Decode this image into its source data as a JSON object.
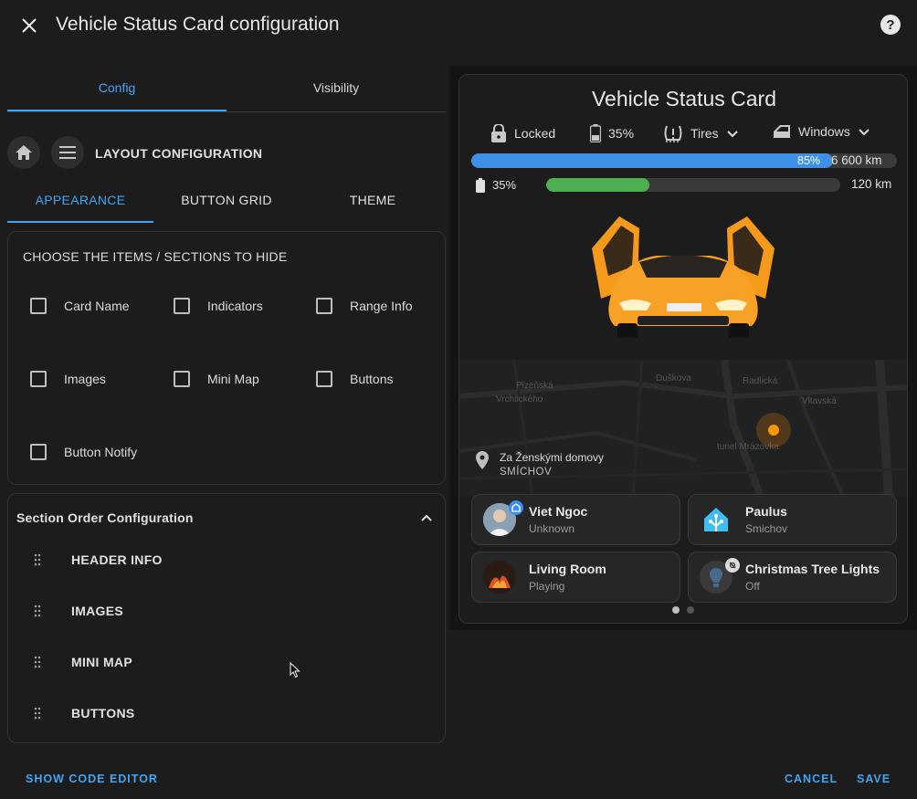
{
  "dialog": {
    "title": "Vehicle Status Card configuration",
    "cancel_label": "CANCEL",
    "save_label": "SAVE",
    "code_editor_label": "SHOW CODE EDITOR"
  },
  "main_tabs": [
    {
      "label": "Config",
      "active": true
    },
    {
      "label": "Visibility",
      "active": false
    }
  ],
  "layout": {
    "title": "LAYOUT CONFIGURATION",
    "sub_tabs": [
      {
        "label": "APPEARANCE",
        "active": true
      },
      {
        "label": "BUTTON GRID",
        "active": false
      },
      {
        "label": "THEME",
        "active": false
      }
    ]
  },
  "hide_section": {
    "title": "CHOOSE THE ITEMS / SECTIONS TO HIDE",
    "items": [
      {
        "label": "Card Name",
        "checked": false
      },
      {
        "label": "Indicators",
        "checked": false
      },
      {
        "label": "Range Info",
        "checked": false
      },
      {
        "label": "Images",
        "checked": false
      },
      {
        "label": "Mini Map",
        "checked": false
      },
      {
        "label": "Buttons",
        "checked": false
      },
      {
        "label": "Button Notify",
        "checked": false
      }
    ]
  },
  "section_order": {
    "title": "Section Order Configuration",
    "items": [
      "HEADER INFO",
      "IMAGES",
      "MINI MAP",
      "BUTTONS"
    ]
  },
  "preview": {
    "title": "Vehicle Status Card",
    "indicators": {
      "lock": "Locked",
      "battery": "35%",
      "tires": "Tires",
      "windows": "Windows"
    },
    "range": [
      {
        "percent_label": "85%",
        "value": 85,
        "km": "6 600 km",
        "color": "#3d8fe8"
      },
      {
        "percent_label": "35%",
        "value": 35,
        "km": "120 km",
        "color": "#4caf50"
      }
    ],
    "map": {
      "streets": [
        "Plzeňská",
        "Vrchlického",
        "Duškova",
        "Radlická",
        "Vltavská",
        "tunel Mrázovka"
      ],
      "address_line1": "Za Ženskými domovy",
      "address_line2": "SMÍCHOV"
    },
    "buttons": [
      {
        "name": "Viet Ngoc",
        "state": "Unknown"
      },
      {
        "name": "Paulus",
        "state": "Smichov"
      },
      {
        "name": "Living Room",
        "state": "Playing"
      },
      {
        "name": "Christmas Tree Lights",
        "state": "Off"
      }
    ],
    "accent": "#41a5f5",
    "marker_color": "#ff9800"
  }
}
